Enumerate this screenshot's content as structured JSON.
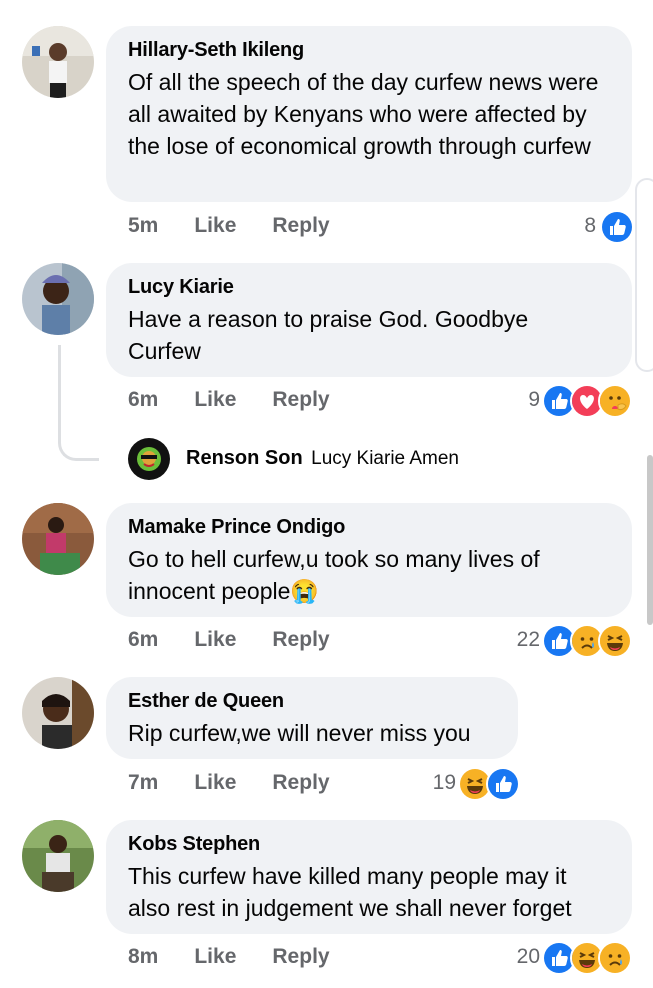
{
  "comments": [
    {
      "author": "Hillary-Seth Ikileng",
      "text": "Of all the speech of the day curfew news were all awaited by Kenyans who were affected by the lose of economical growth through curfew",
      "time": "5m",
      "like": "Like",
      "reply": "Reply",
      "reaction_count": "8",
      "reactions": [
        "like-icon"
      ]
    },
    {
      "author": "Lucy Kiarie",
      "text": "Have a reason to praise God. Goodbye Curfew",
      "time": "6m",
      "like": "Like",
      "reply": "Reply",
      "reaction_count": "9",
      "reactions": [
        "like-icon",
        "love-icon",
        "care-icon"
      ]
    },
    {
      "author": "Mamake Prince Ondigo",
      "text": "Go to hell curfew,u took so many lives of innocent people😭",
      "time": "6m",
      "like": "Like",
      "reply": "Reply",
      "reaction_count": "22",
      "reactions": [
        "like-icon",
        "sad-icon",
        "haha-icon"
      ]
    },
    {
      "author": "Esther de Queen",
      "text": "Rip curfew,we will never miss you",
      "time": "7m",
      "like": "Like",
      "reply": "Reply",
      "reaction_count": "19",
      "reactions": [
        "haha-icon",
        "like-icon"
      ]
    },
    {
      "author": "Kobs Stephen",
      "text": "This curfew have killed many people  may it also rest in judgement we  shall never forget",
      "time": "8m",
      "like": "Like",
      "reply": "Reply",
      "reaction_count": "20",
      "reactions": [
        "like-icon",
        "haha-icon",
        "sad-icon"
      ]
    }
  ],
  "reply_preview": {
    "author": "Renson Son",
    "text": "Lucy Kiarie Amen"
  },
  "colors": {
    "bubble": "#f0f2f5",
    "like_blue": "#1877f2",
    "love_red": "#f33e58",
    "meta_gray": "#65676b"
  }
}
